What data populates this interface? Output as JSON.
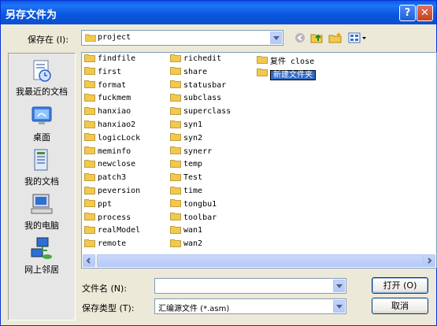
{
  "window": {
    "title": "另存文件为"
  },
  "titlebar_buttons": {
    "help": "?",
    "close": "✕"
  },
  "save_in": {
    "label": "保存在 (I):",
    "value": "project"
  },
  "places": [
    {
      "label": "我最近的文档",
      "icon": "recent-documents-icon"
    },
    {
      "label": "桌面",
      "icon": "desktop-icon"
    },
    {
      "label": "我的文档",
      "icon": "my-documents-icon"
    },
    {
      "label": "我的电脑",
      "icon": "my-computer-icon"
    },
    {
      "label": "网上邻居",
      "icon": "network-places-icon"
    }
  ],
  "files": {
    "col1": [
      "findfile",
      "first",
      "format",
      "fuckmem",
      "hanxiao",
      "hanxiao2",
      "logicLock",
      "meminfo",
      "newclose",
      "patch3",
      "peversion",
      "ppt",
      "process",
      "realModel",
      "remote"
    ],
    "col2": [
      "richedit",
      "share",
      "statusbar",
      "subclass",
      "superclass",
      "syn1",
      "syn2",
      "synerr",
      "temp",
      "Test",
      "time",
      "tongbu1",
      "toolbar",
      "wan1",
      "wan2"
    ],
    "col3": [
      "复件 close",
      "新建文件夹"
    ]
  },
  "filename": {
    "label": "文件名 (N):",
    "value": ""
  },
  "filetype": {
    "label": "保存类型 (T):",
    "value": "汇编源文件 (*.asm)"
  },
  "buttons": {
    "open": "打开 (O)",
    "cancel": "取消"
  },
  "colors": {
    "titlebar": "#0a5ce6",
    "folder": "#f2c94c",
    "selection": "#316ac5"
  }
}
